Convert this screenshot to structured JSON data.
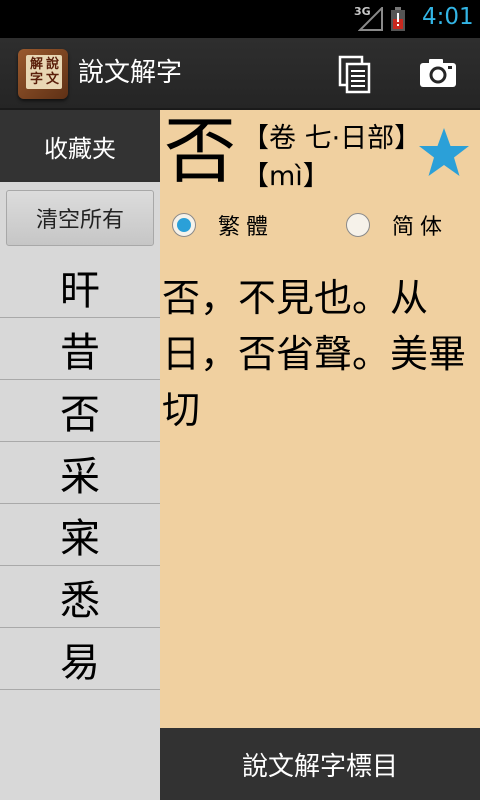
{
  "status": {
    "network": "3G",
    "time": "4:01"
  },
  "actionbar": {
    "app_icon_chars": [
      "說",
      "解",
      "文",
      "字"
    ],
    "title": "說文解字",
    "copy_icon": "copy-icon",
    "camera_icon": "camera-icon"
  },
  "sidebar": {
    "header": "收藏夹",
    "clear_label": "清空所有",
    "items": [
      "旰",
      "昔",
      "否",
      "采",
      "宷",
      "悉",
      "易"
    ]
  },
  "entry": {
    "character": "否",
    "volume": "【卷 七·日部】",
    "pinyin": "【mì】",
    "star_icon": "star-icon",
    "star_color": "#2ba0d8",
    "radio_traditional": "繁體",
    "radio_simplified": "简体",
    "selected": "traditional",
    "definition": "否，不見也。从日，否省聲。美畢切"
  },
  "bottom": {
    "label": "說文解字標目"
  }
}
